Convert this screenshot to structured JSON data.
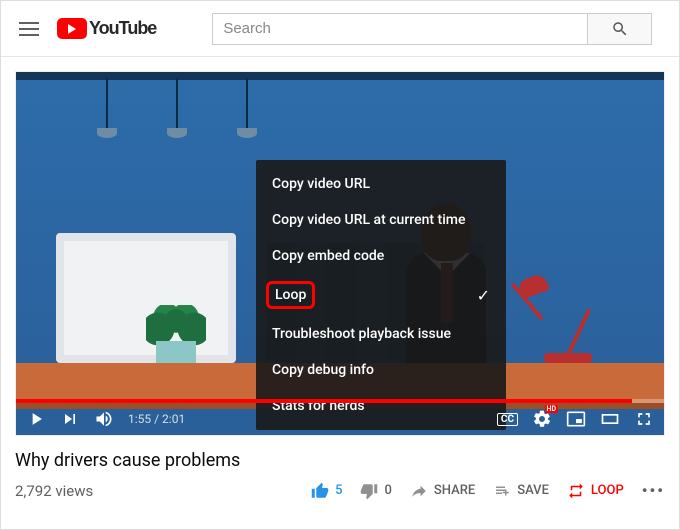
{
  "header": {
    "brand": "YouTube",
    "search_placeholder": "Search"
  },
  "context_menu": {
    "items": [
      {
        "label": "Copy video URL",
        "checked": false
      },
      {
        "label": "Copy video URL at current time",
        "checked": false
      },
      {
        "label": "Copy embed code",
        "checked": false
      },
      {
        "label": "Loop",
        "checked": true,
        "highlighted": true
      },
      {
        "label": "Troubleshoot playback issue",
        "checked": false
      },
      {
        "label": "Copy debug info",
        "checked": false
      },
      {
        "label": "Stats for nerds",
        "checked": false
      }
    ]
  },
  "player": {
    "current_time": "1:55",
    "duration": "2:01",
    "time_display": "1:55 / 2:01",
    "progress_percent": 95,
    "cc_label": "CC",
    "quality_badge": "HD"
  },
  "video": {
    "title": "Why drivers cause problems",
    "views": "2,792 views"
  },
  "actions": {
    "likes": "5",
    "dislikes": "0",
    "share": "SHARE",
    "save": "SAVE",
    "loop": "LOOP"
  }
}
